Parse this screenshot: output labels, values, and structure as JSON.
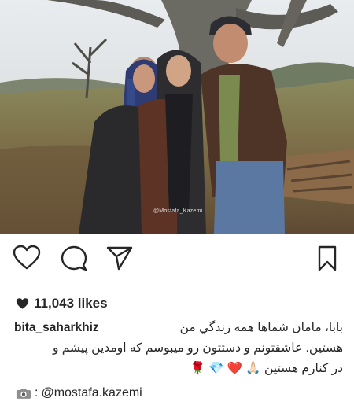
{
  "post": {
    "photo_watermark": "@Mostafa_Kazemi",
    "likes_text": "11,043 likes",
    "username": "bita_saharkhiz",
    "caption_line1": "بابا، مامان شماها همه زندگي من",
    "caption_line2": "هستين. عاشقتونم و دستتون رو ميبوسم كه اومدين پيشم و",
    "caption_line3_emoji": "🌹 💎 ❤️ 🙏🏻",
    "caption_line3_text": "در كنارم هستين",
    "credit_prefix": ":",
    "credit_mention": "@mostafa.kazemi"
  },
  "icons": {
    "like": "heart-outline-icon",
    "comment": "comment-bubble-icon",
    "share": "paper-plane-icon",
    "save": "bookmark-icon",
    "likes_marker": "heart-filled-icon",
    "camera": "camera-icon"
  }
}
